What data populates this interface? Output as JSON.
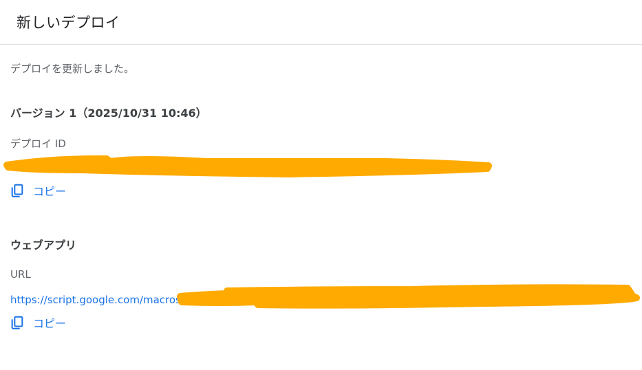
{
  "dialog": {
    "title": "新しいデプロイ"
  },
  "message": "デプロイを更新しました。",
  "version": {
    "label": "バージョン 1（2025/10/31 10:46）"
  },
  "deploy_id": {
    "label": "デプロイ ID",
    "copy_label": "コピー"
  },
  "webapp": {
    "label": "ウェブアプリ",
    "url_label": "URL",
    "url_text": "https://script.google.com/macros",
    "ellipsis": "...",
    "copy_label": "コピー"
  },
  "colors": {
    "accent": "#1a73e8",
    "redaction": "#ffaa00"
  },
  "icons": {
    "copy": "copy-icon"
  }
}
